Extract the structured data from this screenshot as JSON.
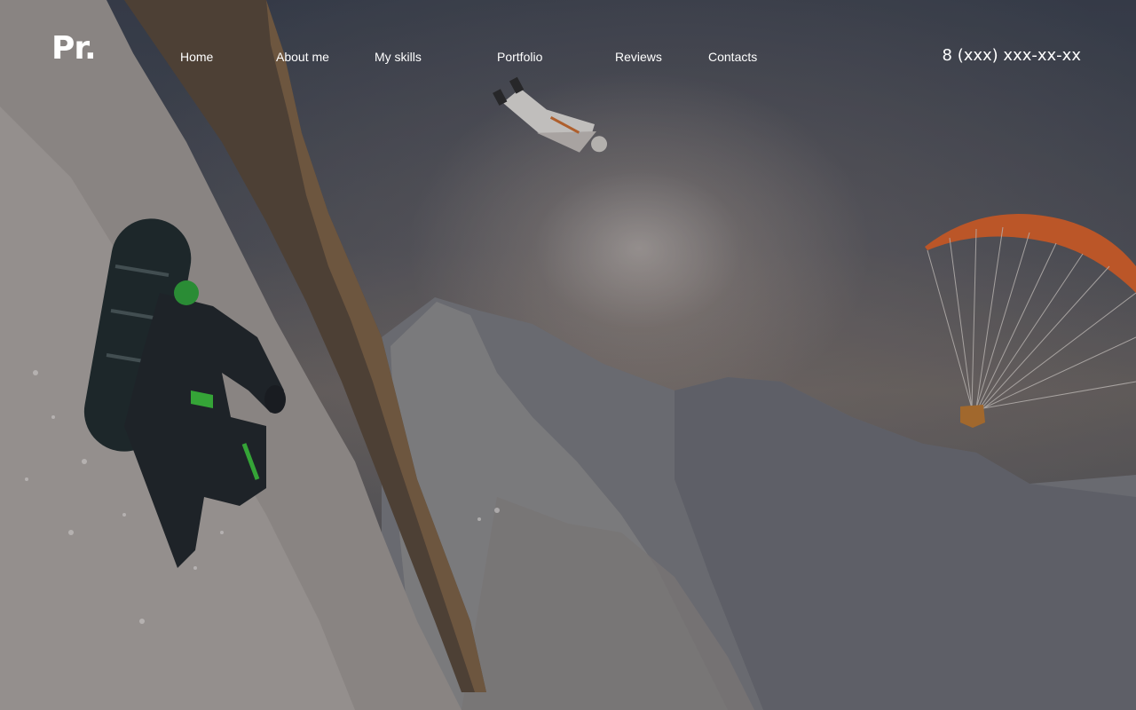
{
  "header": {
    "logo": "Pr.",
    "phone": "8 (xxx) xxx-xx-xx"
  },
  "nav": {
    "items": [
      {
        "label": "Home"
      },
      {
        "label": "About me"
      },
      {
        "label": "My skills"
      },
      {
        "label": "Portfolio"
      },
      {
        "label": "Reviews"
      },
      {
        "label": "Contacts"
      }
    ]
  },
  "colors": {
    "text": "#ffffff",
    "paraglider_wing": "#e0642a",
    "snowboarder_accent": "#3cc43c"
  }
}
